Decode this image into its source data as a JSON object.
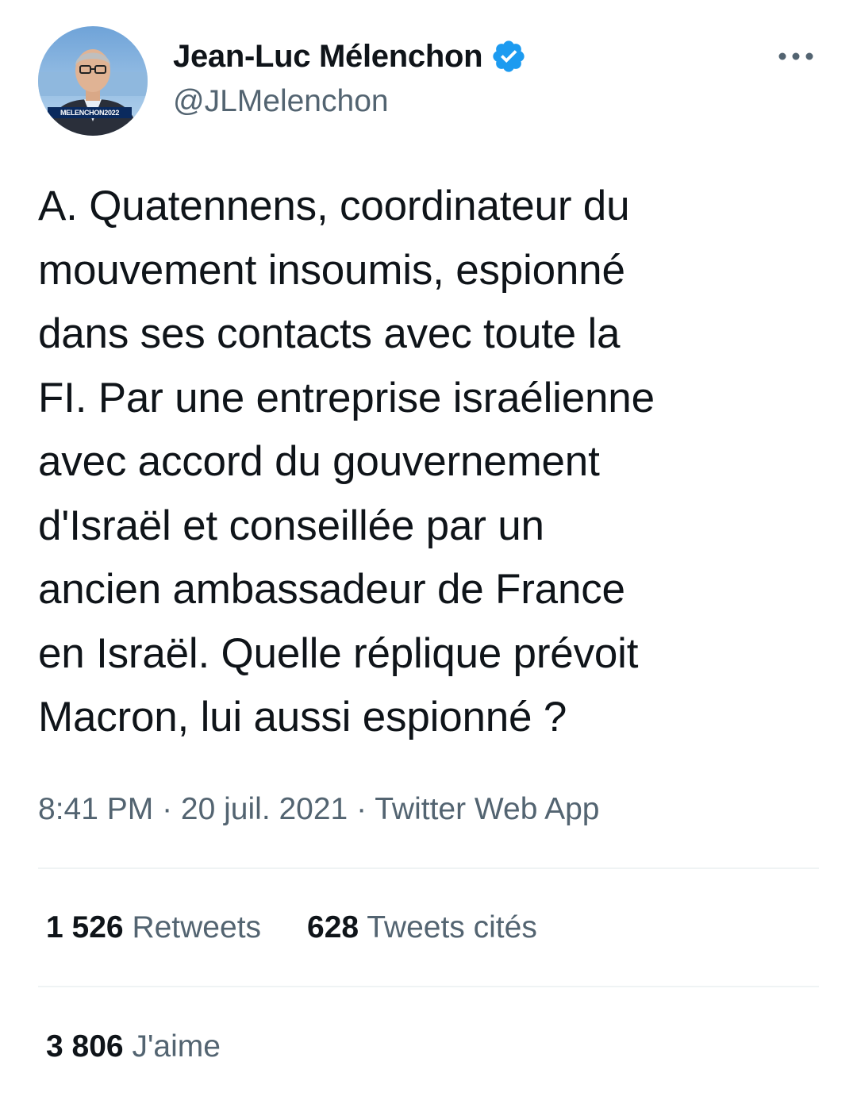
{
  "author": {
    "name": "Jean-Luc Mélenchon",
    "handle": "@JLMelenchon",
    "verified": true,
    "avatar_banner_text": "MELENCHON2022"
  },
  "tweet": {
    "text": "A. Quatennens, coordinateur du\nmouvement insoumis, espionné\ndans ses contacts avec toute la\nFI. Par une entreprise israélienne\navec accord du gouvernement\nd'Israël et conseillée par un\nancien ambassadeur de France\nen Israël. Quelle réplique prévoit\nMacron, lui aussi espionné ?",
    "time": "8:41 PM",
    "separator": " · ",
    "date": "20 juil. 2021",
    "source": "Twitter Web App"
  },
  "stats": {
    "retweets_count": "1 526",
    "retweets_label": "Retweets",
    "quotes_count": "628",
    "quotes_label": "Tweets cités",
    "likes_count": "3 806",
    "likes_label": "J'aime"
  },
  "colors": {
    "text_primary": "#0f1419",
    "text_secondary": "#536471",
    "verified_blue": "#1d9bf0",
    "divider": "#eff3f4"
  },
  "icons": {
    "verified": "verified-badge-icon",
    "more": "more-options-icon"
  }
}
